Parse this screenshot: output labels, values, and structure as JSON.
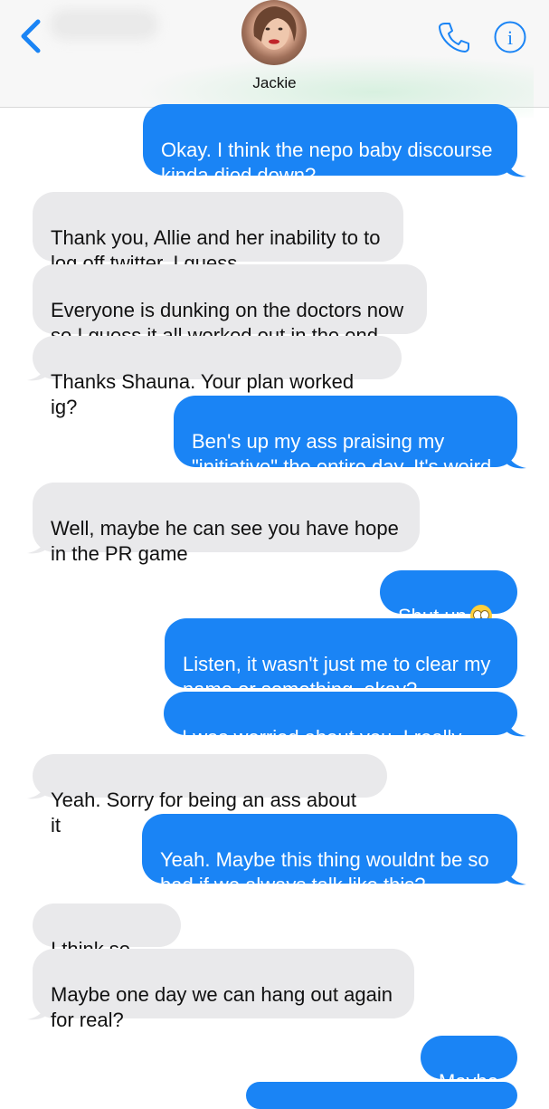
{
  "header": {
    "contact_name": "Jackie",
    "back_icon": "chevron-left-icon",
    "call_icon": "phone-icon",
    "info_icon": "info-icon",
    "accent": "#1a84f5"
  },
  "colors": {
    "outgoing_bubble": "#1a84f5",
    "incoming_bubble": "#e9e9eb"
  },
  "messages": [
    {
      "side": "out",
      "text": "Okay. I think the nepo baby discourse\nkinda died down?"
    },
    {
      "side": "in",
      "text": "Thank you, Allie and her inability to to\nlog off twitter, I guess"
    },
    {
      "side": "in",
      "text": "Everyone is dunking on the doctors now\nso I guess it all worked out in the end"
    },
    {
      "side": "in",
      "text": "Thanks Shauna. Your plan worked ig?"
    },
    {
      "side": "out",
      "text": "Ben's up my ass praising my\n\"initiative\" the entire day. It's weird"
    },
    {
      "side": "in",
      "text": "Well, maybe he can see you have hope\nin the PR game"
    },
    {
      "side": "out",
      "text": "Shut up",
      "emoji": "eye-roll-emoji"
    },
    {
      "side": "out",
      "text": "Listen, it wasn't just me to clear my\nname or something, okay?"
    },
    {
      "side": "out",
      "text": "I was worried about you. I really was"
    },
    {
      "side": "in",
      "text": "Yeah. Sorry for being an ass about it"
    },
    {
      "side": "out",
      "text": "Yeah. Maybe this thing wouldnt be so\nbad if we always talk like this?"
    },
    {
      "side": "in",
      "text": "I think so too"
    },
    {
      "side": "in",
      "text": "Maybe one day we can hang out again\nfor real?"
    },
    {
      "side": "out",
      "text": "Maybe"
    }
  ]
}
